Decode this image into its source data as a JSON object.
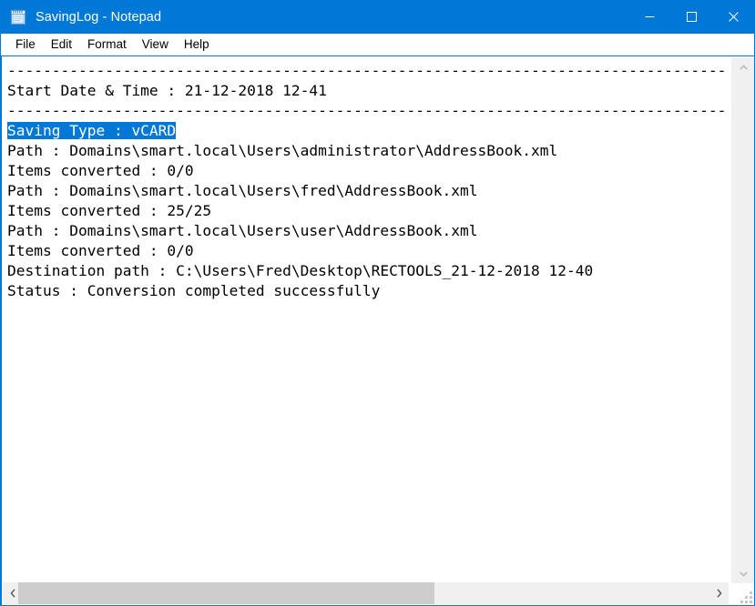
{
  "window": {
    "title": "SavingLog - Notepad",
    "icon": "notepad-icon",
    "accent_color": "#0078d7",
    "controls": {
      "minimize": "minimize-icon",
      "maximize": "maximize-icon",
      "close": "close-icon"
    }
  },
  "menubar": {
    "items": [
      {
        "label": "File"
      },
      {
        "label": "Edit"
      },
      {
        "label": "Format"
      },
      {
        "label": "View"
      },
      {
        "label": "Help"
      }
    ]
  },
  "document": {
    "filename": "SavingLog",
    "lines": [
      {
        "text": "---------------------------------------------------------------------------------",
        "selected": false
      },
      {
        "text": "Start Date & Time : 21-12-2018 12-41",
        "selected": false
      },
      {
        "text": "---------------------------------------------------------------------------------",
        "selected": false
      },
      {
        "text": "Saving Type : vCARD",
        "selected": true
      },
      {
        "text": "Path : Domains\\smart.local\\Users\\administrator\\AddressBook.xml",
        "selected": false
      },
      {
        "text": "Items converted : 0/0",
        "selected": false
      },
      {
        "text": "Path : Domains\\smart.local\\Users\\fred\\AddressBook.xml",
        "selected": false
      },
      {
        "text": "Items converted : 25/25",
        "selected": false
      },
      {
        "text": "Path : Domains\\smart.local\\Users\\user\\AddressBook.xml",
        "selected": false
      },
      {
        "text": "Items converted : 0/0",
        "selected": false
      },
      {
        "text": "Destination path : C:\\Users\\Fred\\Desktop\\RECTOOLS_21-12-2018 12-40",
        "selected": false
      },
      {
        "text": "Status : Conversion completed successfully",
        "selected": false
      }
    ],
    "selection": {
      "text": "Saving Type : vCARD",
      "highlight_color": "#0078d7",
      "highlight_text_color": "#ffffff"
    }
  },
  "scrollbars": {
    "vertical": {
      "up_arrow": "chevron-up-icon",
      "down_arrow": "chevron-down-icon"
    },
    "horizontal": {
      "left_arrow": "chevron-left-icon",
      "right_arrow": "chevron-right-icon"
    },
    "resize_grip": "resize-grip-icon"
  }
}
